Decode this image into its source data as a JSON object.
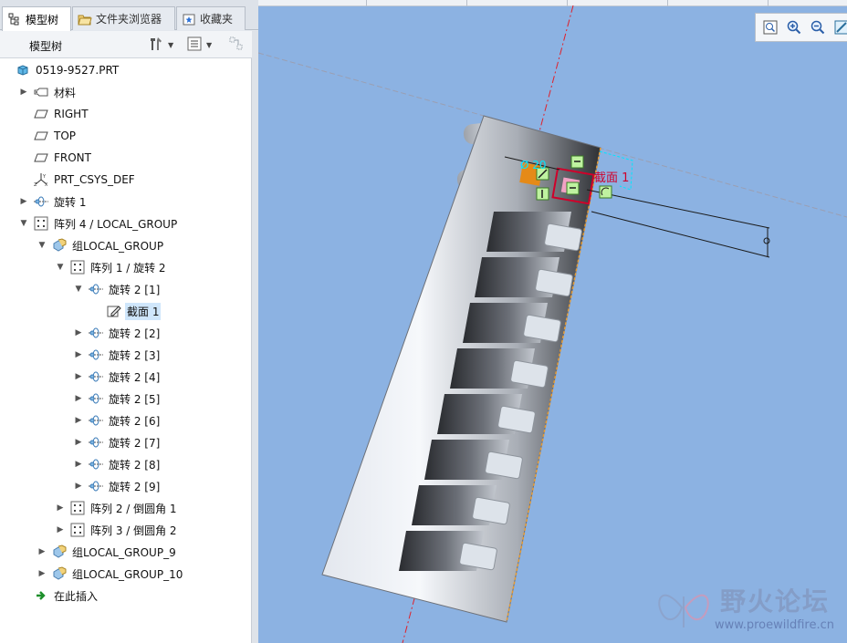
{
  "tabs": [
    {
      "label": "模型树"
    },
    {
      "label": "文件夹浏览器"
    },
    {
      "label": "收藏夹"
    }
  ],
  "tree_header": {
    "title": "模型树"
  },
  "tree": {
    "root": "0519-9527.PRT",
    "items": [
      {
        "label": "材料"
      },
      {
        "label": "RIGHT"
      },
      {
        "label": "TOP"
      },
      {
        "label": "FRONT"
      },
      {
        "label": "PRT_CSYS_DEF"
      },
      {
        "label": "旋转 1"
      },
      {
        "label": "阵列 4 / LOCAL_GROUP"
      },
      {
        "label": "组LOCAL_GROUP"
      },
      {
        "label": "阵列 1 / 旋转 2"
      },
      {
        "label": "旋转 2 [1]"
      },
      {
        "label": "截面 1"
      },
      {
        "label": "旋转 2 [2]"
      },
      {
        "label": "旋转 2 [3]"
      },
      {
        "label": "旋转 2 [4]"
      },
      {
        "label": "旋转 2 [5]"
      },
      {
        "label": "旋转 2 [6]"
      },
      {
        "label": "旋转 2 [7]"
      },
      {
        "label": "旋转 2 [8]"
      },
      {
        "label": "旋转 2 [9]"
      },
      {
        "label": "阵列 2 / 倒圆角 1"
      },
      {
        "label": "阵列 3 / 倒圆角 2"
      },
      {
        "label": "组LOCAL_GROUP_9"
      },
      {
        "label": "组LOCAL_GROUP_10"
      },
      {
        "label": "在此插入"
      }
    ]
  },
  "viewport": {
    "dimension_label": "Ø 20",
    "section_label": "截面 1",
    "background_color": "#8cb2e2"
  },
  "watermark": {
    "text": "野火论坛",
    "url": "www.proewildfire.cn"
  },
  "colors": {
    "selection": "#cfe6fb",
    "sketch_red": "#d0002a",
    "dimension_cyan": "#00e6ff",
    "axis_red": "#e0202a"
  }
}
